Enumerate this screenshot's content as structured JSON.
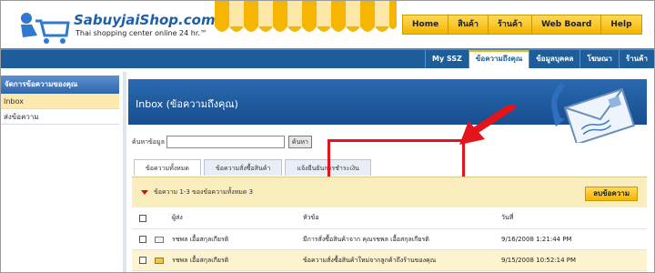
{
  "brand": {
    "logo_text": "SabuyjaiShop.com",
    "logo_reg": "®",
    "tagline": "Thai shopping center online 24 hr.™"
  },
  "top_nav": [
    "Home",
    "สินค้า",
    "ร้านค้า",
    "Web Board",
    "Help"
  ],
  "sub_nav": {
    "items": [
      "My SSZ",
      "ข้อความถึงคุณ",
      "ข้อมูลบุคคล",
      "โฆษณา",
      "ร้านค้า"
    ],
    "active_index": 1
  },
  "sidebar": {
    "title": "จัดการข้อความของคุณ",
    "items": [
      "Inbox",
      "ส่งข้อความ"
    ],
    "active_index": 0
  },
  "main": {
    "title": "Inbox (ข้อความถึงคุณ)",
    "search_label": "ค้นหาข้อมูล",
    "search_value": "",
    "search_button": "ค้นหา",
    "tabs": [
      "ข้อความทั้งหมด",
      "ข้อความสั่งซื้อสินค้า",
      "แจ้งยืนยันการชำระเงิน"
    ],
    "active_tab": 0,
    "count_text": "ข้อความ 1-3 ของข้อความทั้งหมด 3",
    "delete_button": "ลบข้อความ",
    "columns": {
      "from": "ผู้ส่ง",
      "subject": "หัวข้อ",
      "date": "วันที่"
    },
    "rows": [
      {
        "from": "รชพล เอื้อสกุลเกียรติ",
        "subject": "มีการสั่งซื้อสินค้าจาก คุณรชพล เอื้อสกุลเกียรติ",
        "date": "9/16/2008 1:21:44 PM",
        "icon": "envelope-icon"
      },
      {
        "from": "รชพล เอื้อสกุลเกียรติ",
        "subject": "ข้อความสั่งซื้อสินค้าใหม่จากลูกค้าถึงร้านของคุณ",
        "date": "9/15/2008 10:52:14 PM",
        "icon": "envelope-unread-icon"
      }
    ]
  },
  "colors": {
    "brand_blue": "#1c5d9a",
    "accent_yellow": "#f5b500",
    "highlight_red": "#e3141b"
  }
}
